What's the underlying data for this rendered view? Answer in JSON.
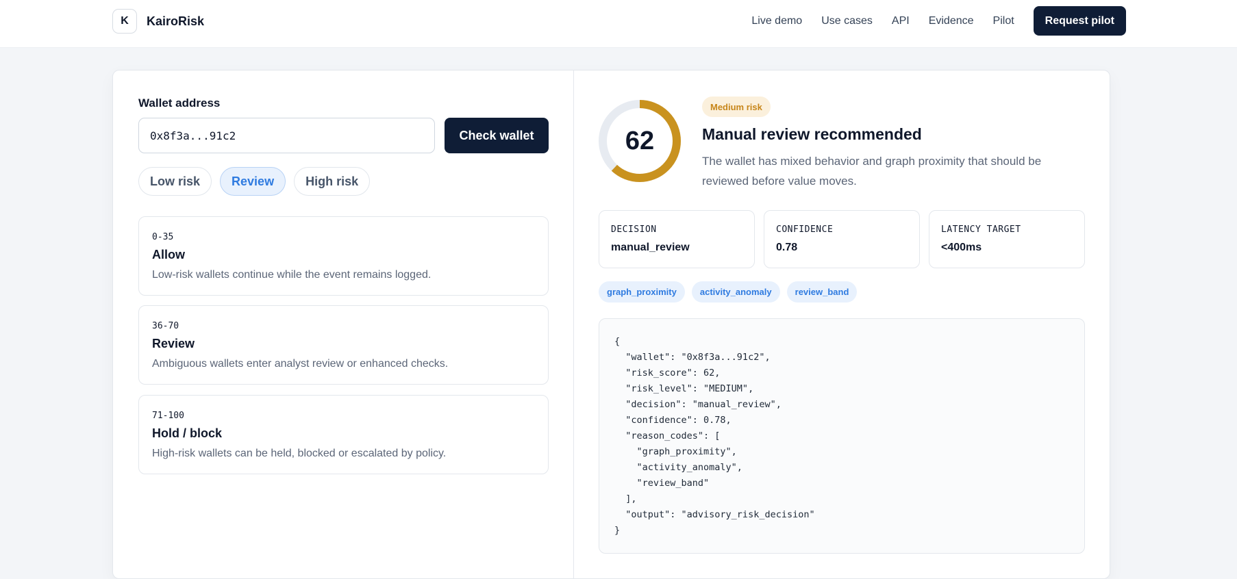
{
  "header": {
    "logo_letter": "K",
    "brand": "KairoRisk",
    "nav": [
      "Live demo",
      "Use cases",
      "API",
      "Evidence",
      "Pilot"
    ],
    "cta": "Request pilot"
  },
  "checker": {
    "label": "Wallet address",
    "input_value": "0x8f3a...91c2",
    "button": "Check wallet",
    "presets": [
      "Low risk",
      "Review",
      "High risk"
    ],
    "active_preset": "Review"
  },
  "bands": [
    {
      "range": "0-35",
      "title": "Allow",
      "desc": "Low-risk wallets continue while the event remains logged."
    },
    {
      "range": "36-70",
      "title": "Review",
      "desc": "Ambiguous wallets enter analyst review or enhanced checks."
    },
    {
      "range": "71-100",
      "title": "Hold / block",
      "desc": "High-risk wallets can be held, blocked or escalated by policy."
    }
  ],
  "result": {
    "score": "62",
    "score_fraction": 0.62,
    "gauge_color": "#c9921f",
    "gauge_track": "#e7ebf1",
    "badge": "Medium risk",
    "title": "Manual review recommended",
    "desc": "The wallet has mixed behavior and graph proximity that should be reviewed before value moves.",
    "metrics": [
      {
        "label": "DECISION",
        "value": "manual_review"
      },
      {
        "label": "CONFIDENCE",
        "value": "0.78"
      },
      {
        "label": "LATENCY TARGET",
        "value": "<400ms"
      }
    ],
    "tags": [
      "graph_proximity",
      "activity_anomaly",
      "review_band"
    ],
    "json_lines": [
      "{",
      "  \"wallet\": \"0x8f3a...91c2\",",
      "  \"risk_score\": 62,",
      "  \"risk_level\": \"MEDIUM\",",
      "  \"decision\": \"manual_review\",",
      "  \"confidence\": 0.78,",
      "  \"reason_codes\": [",
      "    \"graph_proximity\",",
      "    \"activity_anomaly\",",
      "    \"review_band\"",
      "  ],",
      "  \"output\": \"advisory_risk_decision\"",
      "}"
    ]
  }
}
